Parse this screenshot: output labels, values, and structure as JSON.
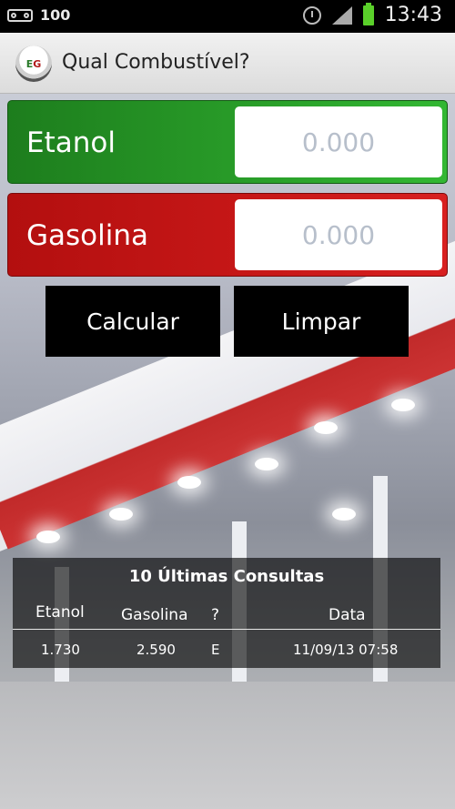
{
  "status_bar": {
    "battery_level": "100",
    "time": "13:43",
    "icons": [
      "voicemail-icon",
      "alarm-icon",
      "signal-icon",
      "battery-icon"
    ]
  },
  "action_bar": {
    "logo_text_e": "E",
    "logo_text_g": "G",
    "title": "Qual Combustível?"
  },
  "fuels": {
    "etanol": {
      "label": "Etanol",
      "placeholder": "0.000",
      "color": "#2aa02a"
    },
    "gasolina": {
      "label": "Gasolina",
      "placeholder": "0.000",
      "color": "#c81818"
    }
  },
  "buttons": {
    "calculate": "Calcular",
    "clear": "Limpar"
  },
  "history": {
    "title": "10 Últimas Consultas",
    "columns": [
      "Etanol",
      "Gasolina",
      "?",
      "Data"
    ],
    "rows": [
      [
        "1.730",
        "2.590",
        "E",
        "11/09/13 07:58"
      ]
    ]
  }
}
